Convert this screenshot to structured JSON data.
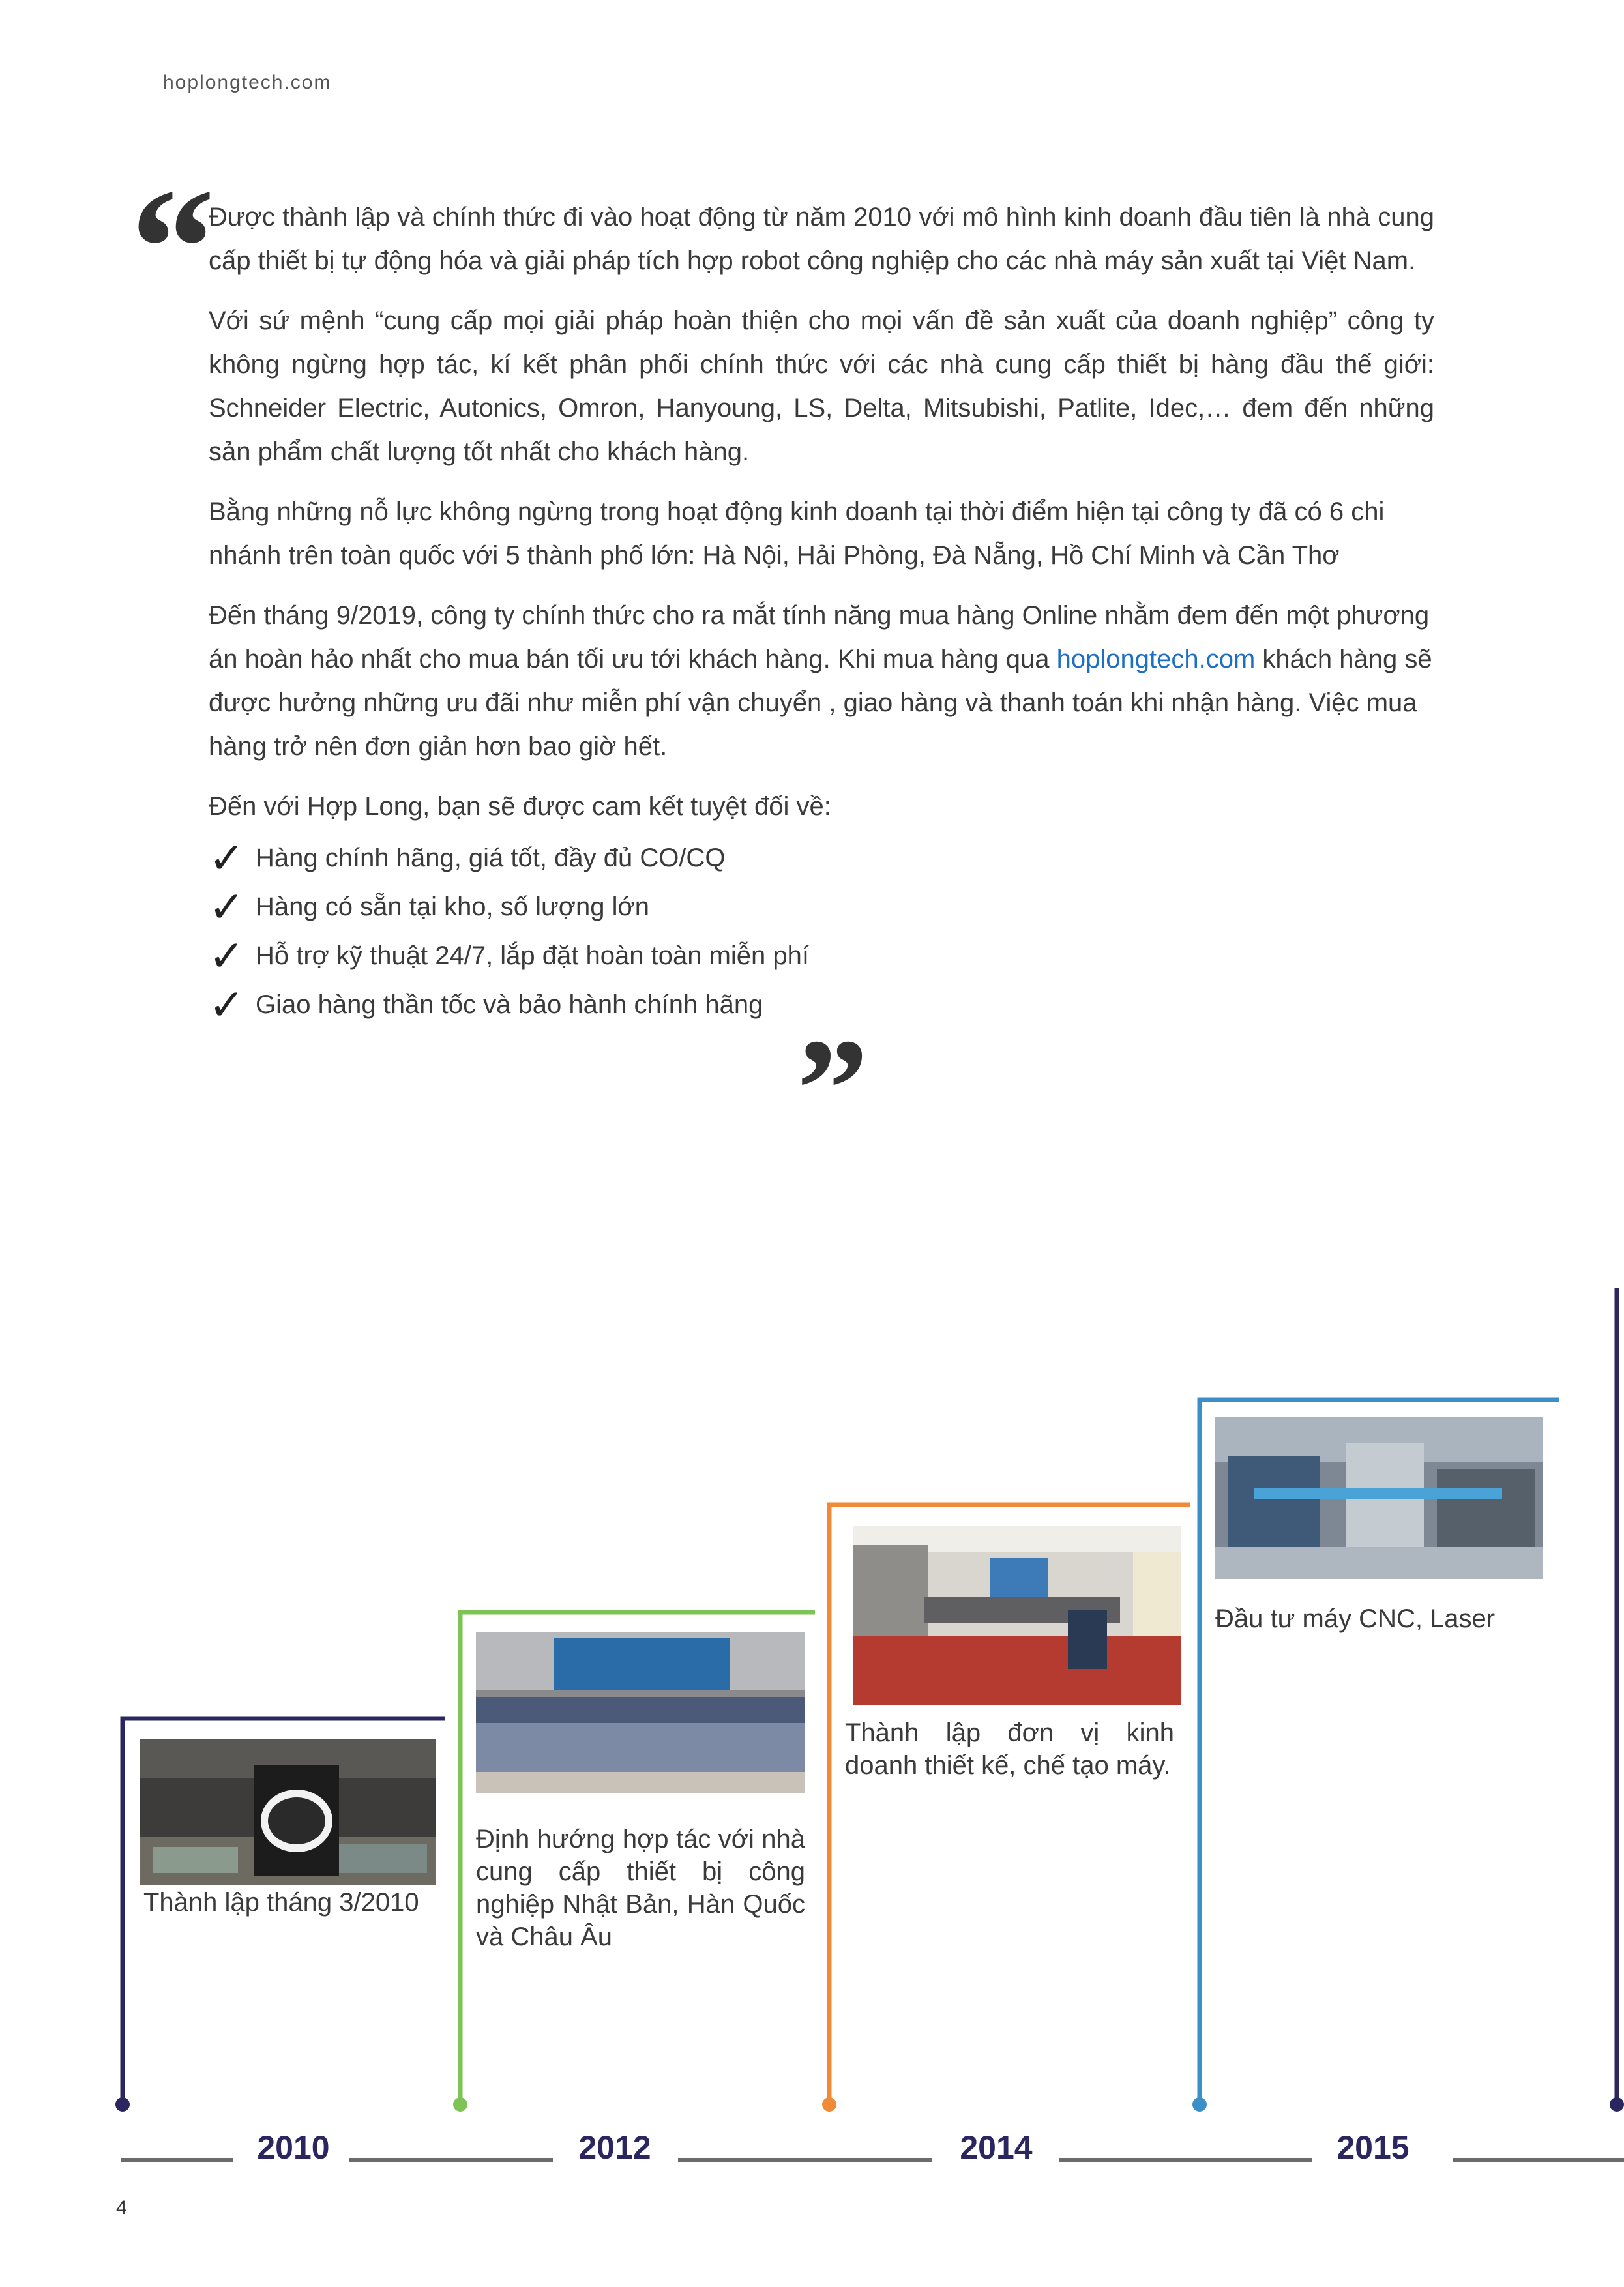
{
  "header": {
    "site": "hoplongtech.com"
  },
  "intro": {
    "p1": "Được thành lập và chính thức đi vào hoạt động từ năm 2010 với mô hình kinh doanh đầu tiên là nhà cung cấp thiết bị tự động hóa và giải pháp tích hợp robot công nghiệp cho các nhà máy sản xuất tại Việt Nam.",
    "p2": "Với sứ mệnh “cung cấp mọi giải pháp hoàn thiện cho mọi vấn đề sản xuất của doanh nghiệp” công ty không ngừng hợp tác, kí kết phân phối chính thức với các nhà cung cấp thiết bị hàng đầu thế giới: Schneider Electric, Autonics, Omron, Hanyoung, LS, Delta, Mitsubishi, Patlite, Idec,… đem đến những sản phẩm chất lượng tốt nhất cho khách hàng.",
    "p3": "Bằng những nỗ lực không ngừng trong hoạt động kinh doanh tại thời điểm hiện tại công ty đã có 6 chi nhánh trên toàn quốc với 5 thành phố lớn: Hà Nội, Hải Phòng, Đà Nẵng, Hồ Chí Minh và Cần Thơ",
    "p4_before": "Đến tháng 9/2019, công ty chính thức cho ra mắt tính năng mua hàng Online nhằm đem đến một phương án hoàn hảo nhất cho mua bán tối ưu tới khách hàng. Khi mua hàng qua ",
    "p4_link": "hoplongtech.com",
    "p4_after": " khách hàng sẽ được hưởng những ưu đãi như miễn phí vận chuyển , giao hàng và thanh toán khi nhận hàng. Việc mua hàng trở nên đơn giản hơn bao giờ hết.",
    "commit_intro": "Đến với Hợp Long, bạn sẽ được cam kết tuyệt đối về:",
    "commitments": [
      "Hàng chính hãng, giá tốt, đầy đủ CO/CQ",
      "Hàng có sẵn tại kho, số lượng lớn",
      "Hỗ trợ kỹ thuật 24/7, lắp đặt hoàn toàn miễn phí",
      "Giao hàng thần tốc và bảo hành chính hãng"
    ],
    "check_glyph": "✓",
    "open_quote_glyph": "“",
    "close_quote_glyph": "”"
  },
  "timeline": {
    "milestones": [
      {
        "year": "2010",
        "caption": "Thành lập tháng 3/2010",
        "color": "#2b2560"
      },
      {
        "year": "2012",
        "caption": "Định hướng hợp tác với nhà cung cấp thiết bị công nghiệp Nhật Bản, Hàn Quốc và Châu Âu",
        "color": "#7dc356"
      },
      {
        "year": "2014",
        "caption": "Thành lập đơn vị kinh doanh thiết kế, chế tạo máy.",
        "color": "#f08a36"
      },
      {
        "year": "2015",
        "caption": "Đầu tư máy CNC, Laser",
        "color": "#3a8fc8"
      }
    ],
    "axis_color": "#6b6b6b",
    "next_color": "#2b2560"
  },
  "footer": {
    "page_number": "4"
  }
}
